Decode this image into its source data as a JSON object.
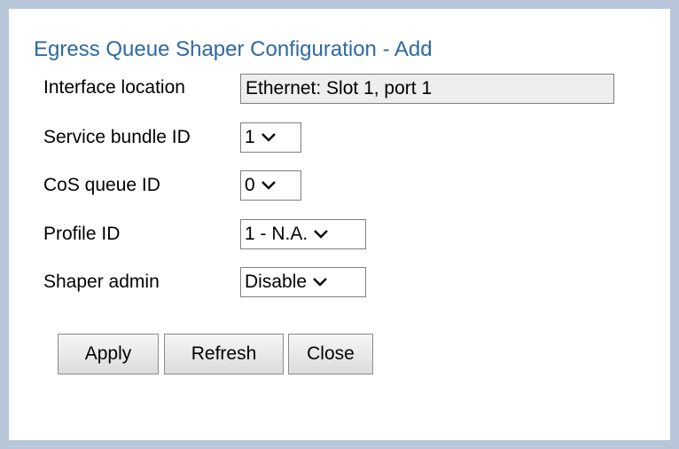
{
  "dialog": {
    "title": "Egress Queue Shaper Configuration - Add"
  },
  "fields": {
    "interface_location": {
      "label": "Interface location",
      "value": "Ethernet: Slot 1, port 1"
    },
    "service_bundle_id": {
      "label": "Service bundle ID",
      "value": "1"
    },
    "cos_queue_id": {
      "label": "CoS queue ID",
      "value": "0"
    },
    "profile_id": {
      "label": "Profile ID",
      "value": "1 - N.A."
    },
    "shaper_admin": {
      "label": "Shaper admin",
      "value": "Disable"
    }
  },
  "buttons": {
    "apply": "Apply",
    "refresh": "Refresh",
    "close": "Close"
  },
  "icons": {
    "dropdown": "chevron-down-icon"
  },
  "colors": {
    "title": "#2d6aa3",
    "frame_border": "#b7c7d9",
    "readonly_bg": "#eeeeee"
  }
}
